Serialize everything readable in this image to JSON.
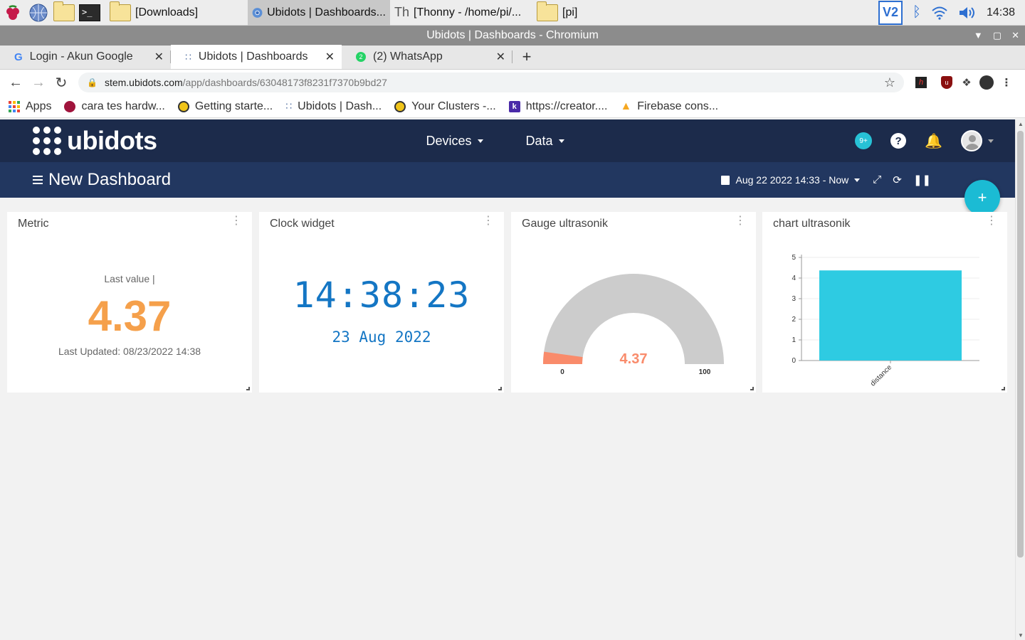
{
  "taskbar": {
    "tasks": [
      {
        "label": "[Downloads]"
      },
      {
        "label": "Ubidots | Dashboards..."
      },
      {
        "label": "[Thonny  -  /home/pi/..."
      },
      {
        "label": "[pi]"
      }
    ],
    "clock": "14:38"
  },
  "window": {
    "title": "Ubidots | Dashboards - Chromium"
  },
  "browser": {
    "tabs": [
      {
        "label": "Login - Akun Google"
      },
      {
        "label": "Ubidots | Dashboards"
      },
      {
        "label": "(2) WhatsApp"
      }
    ],
    "url_host": "stem.ubidots.com",
    "url_path": "/app/dashboards/63048173f8231f7370b9bd27",
    "bookmarks": [
      {
        "label": "Apps"
      },
      {
        "label": "cara tes hardw..."
      },
      {
        "label": "Getting starte..."
      },
      {
        "label": "Ubidots | Dash..."
      },
      {
        "label": "Your Clusters -..."
      },
      {
        "label": "https://creator...."
      },
      {
        "label": "Firebase cons..."
      }
    ]
  },
  "ubidots": {
    "logo_text": "ubidots",
    "menu": [
      {
        "label": "Devices"
      },
      {
        "label": "Data"
      }
    ],
    "notif_count": "9+",
    "dashboard_title": "New Dashboard",
    "date_range": "Aug 22 2022 14:33 - Now",
    "fab": "+"
  },
  "widgets": {
    "metric": {
      "title": "Metric",
      "label": "Last value |",
      "value": "4.37",
      "updated": "Last Updated: 08/23/2022 14:38"
    },
    "clock": {
      "title": "Clock widget",
      "time": "14:38:23",
      "date": "23 Aug 2022"
    },
    "gauge": {
      "title": "Gauge ultrasonik",
      "value": "4.37",
      "min": "0",
      "max": "100",
      "color_fill": "#f98b6b",
      "color_track": "#cccccc"
    },
    "chart": {
      "title": "chart ultrasonik"
    }
  },
  "chart_data": {
    "type": "bar",
    "categories": [
      "distance"
    ],
    "values": [
      4.37
    ],
    "ylim": [
      0,
      5
    ],
    "yticks": [
      "0",
      "1",
      "2",
      "3",
      "4",
      "5"
    ],
    "color": "#2ecbe2"
  },
  "gauge_data": {
    "value": 4.37,
    "min": 0,
    "max": 100
  }
}
